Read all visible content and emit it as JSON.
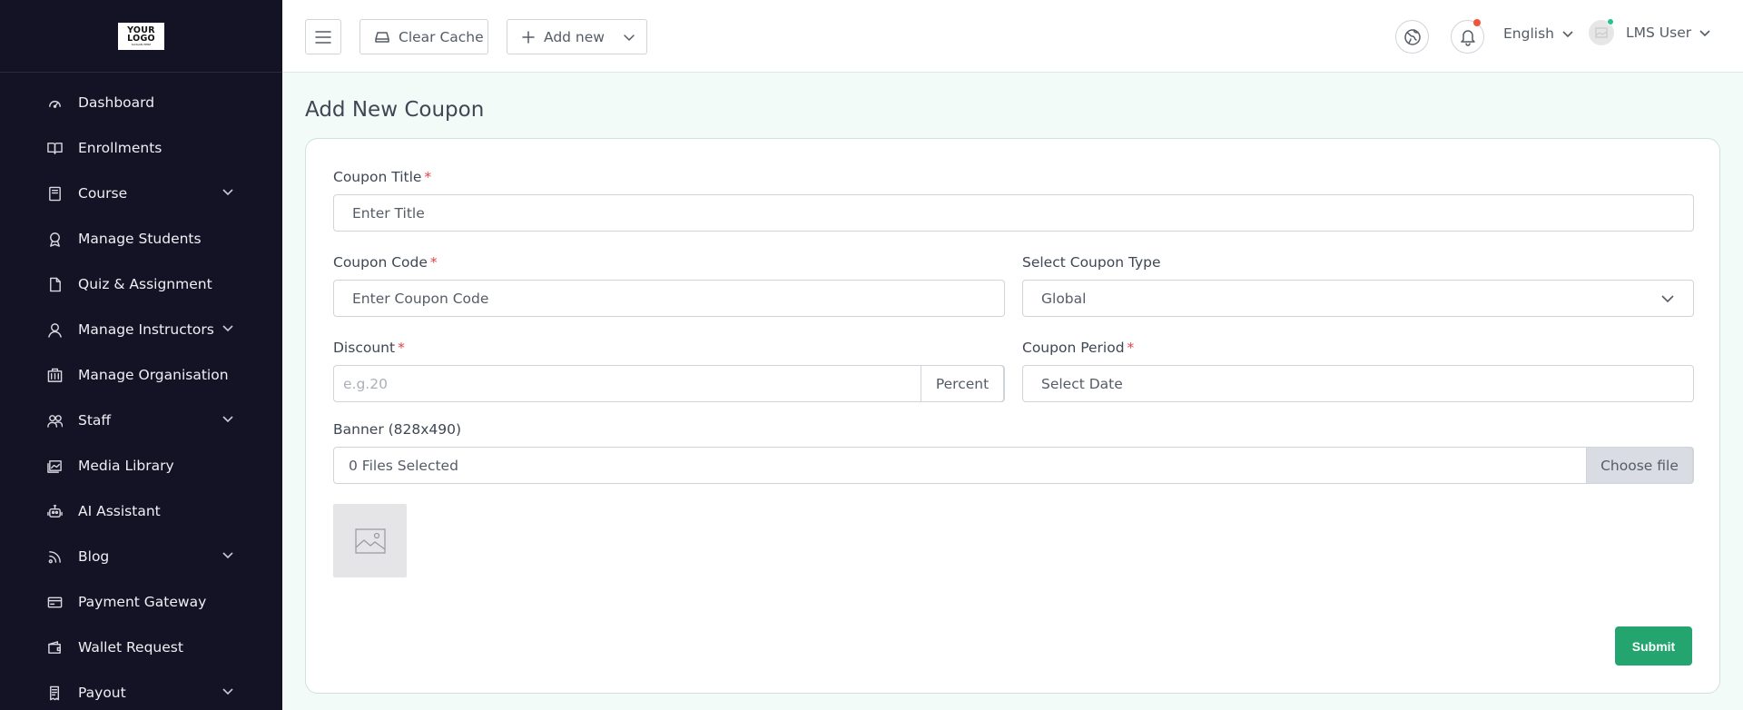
{
  "sidebar": {
    "logo_line1": "YOUR",
    "logo_line2": "LOGO",
    "logo_sub": "SLOGAN HERE",
    "items": [
      {
        "label": "Dashboard",
        "icon": "gauge-icon",
        "expandable": false
      },
      {
        "label": "Enrollments",
        "icon": "book-open-icon",
        "expandable": false
      },
      {
        "label": "Course",
        "icon": "book-icon",
        "expandable": true
      },
      {
        "label": "Manage Students",
        "icon": "award-icon",
        "expandable": false
      },
      {
        "label": "Quiz & Assignment",
        "icon": "file-icon",
        "expandable": false
      },
      {
        "label": "Manage Instructors",
        "icon": "user-icon",
        "expandable": true
      },
      {
        "label": "Manage Organisation",
        "icon": "building-icon",
        "expandable": false
      },
      {
        "label": "Staff",
        "icon": "users-icon",
        "expandable": true
      },
      {
        "label": "Media Library",
        "icon": "media-icon",
        "expandable": false
      },
      {
        "label": "AI Assistant",
        "icon": "robot-icon",
        "expandable": false
      },
      {
        "label": "Blog",
        "icon": "rss-icon",
        "expandable": true
      },
      {
        "label": "Payment Gateway",
        "icon": "credit-card-icon",
        "expandable": false
      },
      {
        "label": "Wallet Request",
        "icon": "wallet-icon",
        "expandable": false
      },
      {
        "label": "Payout",
        "icon": "receipt-icon",
        "expandable": true
      }
    ]
  },
  "topbar": {
    "clear_cache": "Clear Cache",
    "add_new": "Add new",
    "language": "English",
    "user_name": "LMS User"
  },
  "page": {
    "title": "Add New Coupon"
  },
  "form": {
    "coupon_title_label": "Coupon Title",
    "coupon_title_placeholder": "Enter Title",
    "coupon_code_label": "Coupon Code",
    "coupon_code_placeholder": "Enter Coupon Code",
    "coupon_type_label": "Select Coupon Type",
    "coupon_type_value": "Global",
    "discount_label": "Discount",
    "discount_placeholder": "e.g.20",
    "discount_unit": "Percent",
    "period_label": "Coupon Period",
    "period_placeholder": "Select Date",
    "banner_label": "Banner (828x490)",
    "banner_files": "0 Files Selected",
    "choose_file": "Choose file",
    "required_mark": "*",
    "submit": "Submit"
  },
  "colors": {
    "sidebar_bg": "#131325",
    "accent": "#24a46f",
    "required": "#e04545",
    "notification": "#f2553c",
    "online": "#23c48e"
  }
}
